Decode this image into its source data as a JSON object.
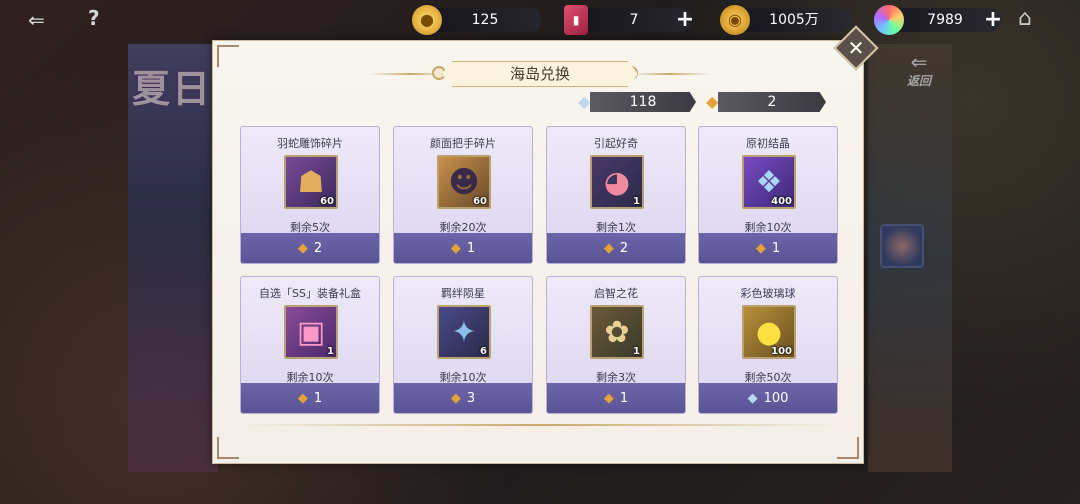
{
  "scene": {
    "banner_title": "夏日",
    "back_label": "返回"
  },
  "resources": [
    {
      "icon": "gold-coin-stack-icon",
      "value": "125",
      "has_plus": false
    },
    {
      "icon": "red-ticket-icon",
      "value": "7",
      "has_plus": true
    },
    {
      "icon": "gold-coin-icon",
      "value": "1005万",
      "has_plus": false
    },
    {
      "icon": "rainbow-gem-icon",
      "value": "7989",
      "has_plus": true
    }
  ],
  "panel": {
    "title": "海岛兑换",
    "currencies": [
      {
        "icon": "blue-shell-icon",
        "value": "118"
      },
      {
        "icon": "gold-shell-icon",
        "value": "2"
      }
    ]
  },
  "items": [
    {
      "name": "羽蛇雕饰碎片",
      "qty": "60",
      "remain": "剩余5次",
      "cost": "2",
      "cost_icon": "gold-shell-icon",
      "thumb_icon": "mask-shard-icon",
      "thumb_bg": "#6a3a8a"
    },
    {
      "name": "颜面把手碎片",
      "qty": "60",
      "remain": "剩余20次",
      "cost": "1",
      "cost_icon": "gold-shell-icon",
      "thumb_icon": "portrait-shard-icon",
      "thumb_bg": "#8a6a3a"
    },
    {
      "name": "引起好奇",
      "qty": "1",
      "remain": "剩余1次",
      "cost": "2",
      "cost_icon": "gold-shell-icon",
      "thumb_icon": "cake-icon",
      "thumb_bg": "#4a3a6a"
    },
    {
      "name": "原初结晶",
      "qty": "400",
      "remain": "剩余10次",
      "cost": "1",
      "cost_icon": "gold-shell-icon",
      "thumb_icon": "crystal-icon",
      "thumb_bg": "#5a3a9a"
    },
    {
      "name": "自选「SS」装备礼盒",
      "qty": "1",
      "remain": "剩余10次",
      "cost": "1",
      "cost_icon": "gold-shell-icon",
      "thumb_icon": "gift-box-icon",
      "thumb_bg": "#6a3a8a"
    },
    {
      "name": "羁绊陨星",
      "qty": "6",
      "remain": "剩余10次",
      "cost": "3",
      "cost_icon": "gold-shell-icon",
      "thumb_icon": "meteor-icon",
      "thumb_bg": "#3a3a6a"
    },
    {
      "name": "启智之花",
      "qty": "1",
      "remain": "剩余3次",
      "cost": "1",
      "cost_icon": "gold-shell-icon",
      "thumb_icon": "flower-icon",
      "thumb_bg": "#5a4a3a"
    },
    {
      "name": "彩色玻璃球",
      "qty": "100",
      "remain": "剩余50次",
      "cost": "100",
      "cost_icon": "blue-shell-icon",
      "thumb_icon": "glass-orb-icon",
      "thumb_bg": "#6a5a2a"
    }
  ]
}
